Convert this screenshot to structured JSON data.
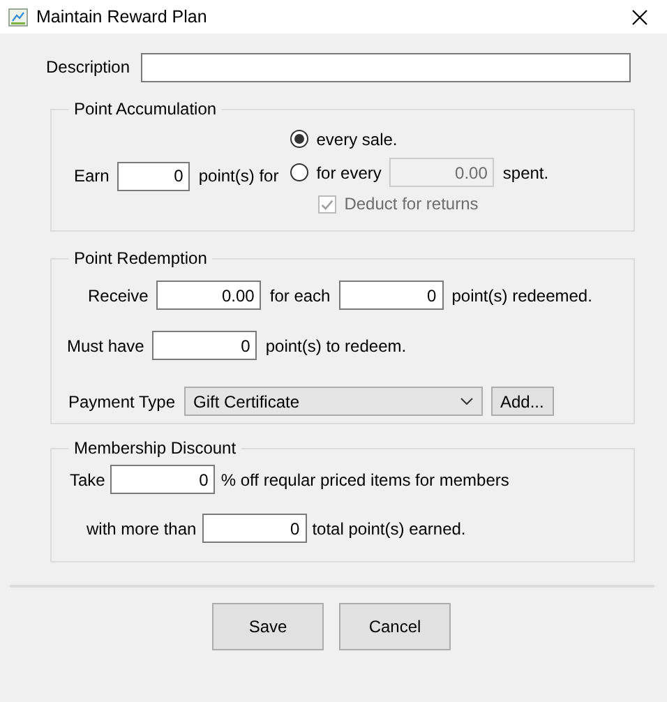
{
  "window": {
    "title": "Maintain Reward Plan"
  },
  "description": {
    "label": "Description"
  },
  "point_accumulation": {
    "title": "Point Accumulation",
    "earn_label": "Earn",
    "points": {
      "value": "0"
    },
    "points_suffix": "point(s) for",
    "options": [
      {
        "label": "every sale.",
        "selected": true
      },
      {
        "label": "for every",
        "selected": false,
        "amount": {
          "value": "0.00",
          "disabled": true
        },
        "suffix": "spent."
      }
    ],
    "deduct_for_returns": {
      "label": "Deduct for returns",
      "checked": true,
      "disabled": true
    }
  },
  "point_redemption": {
    "title": "Point Redemption",
    "receive_label": "Receive",
    "receive": {
      "value": "0.00"
    },
    "for_each_label": "for each",
    "for_each": {
      "value": "0"
    },
    "redeemed_suffix": "point(s) redeemed.",
    "must_have_label": "Must have",
    "must_have": {
      "value": "0"
    },
    "must_have_suffix": "point(s) to redeem.",
    "payment_type_label": "Payment Type",
    "payment_type": {
      "value": "Gift Certificate"
    },
    "add_button": "Add..."
  },
  "membership_discount": {
    "title": "Membership Discount",
    "take_label": "Take",
    "take": {
      "value": "0"
    },
    "take_suffix": "% off reqular priced items for members",
    "more_than_label": "with more than",
    "more_than": {
      "value": "0"
    },
    "more_than_suffix": "total point(s) earned."
  },
  "buttons": [
    "Save",
    "Cancel"
  ]
}
